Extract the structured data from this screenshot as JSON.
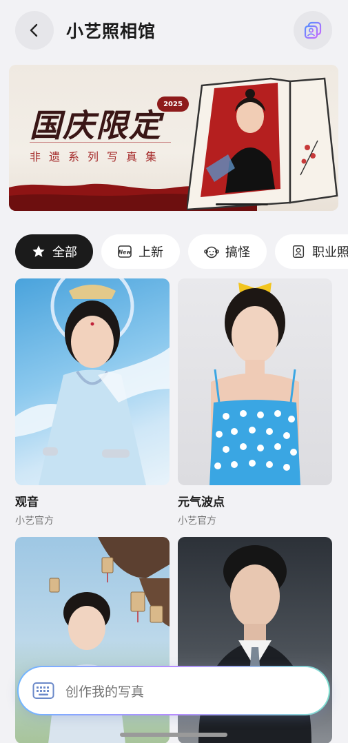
{
  "header": {
    "title": "小艺照相馆"
  },
  "banner": {
    "title": "国庆限定",
    "year": "2025",
    "subtitle": "非遗系列写真集"
  },
  "tabs": [
    {
      "label": "全部",
      "icon": "star-icon",
      "active": true
    },
    {
      "label": "上新",
      "icon": "new-icon",
      "active": false
    },
    {
      "label": "搞怪",
      "icon": "monkey-face-icon",
      "active": false
    },
    {
      "label": "职业照",
      "icon": "id-portrait-icon",
      "active": false
    }
  ],
  "cards": [
    {
      "title": "观音",
      "author": "小艺官方"
    },
    {
      "title": "元气波点",
      "author": "小艺官方"
    },
    {
      "title": "",
      "author": ""
    },
    {
      "title": "",
      "author": ""
    }
  ],
  "create_bar": {
    "placeholder": "创作我的写真",
    "icon": "keyboard-icon"
  },
  "colors": {
    "accent_dark": "#1b1b1b",
    "banner_red": "#8e1b1b",
    "background": "#f2f2f5"
  }
}
